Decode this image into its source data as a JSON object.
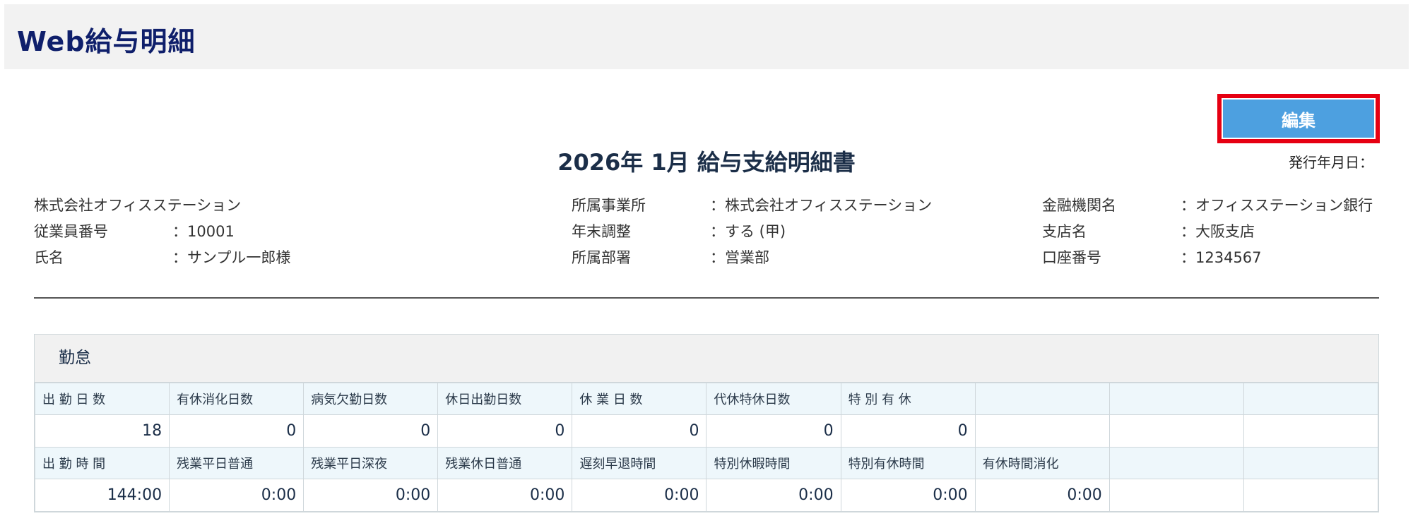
{
  "app": {
    "title": "Web給与明細"
  },
  "toolbar": {
    "edit_label": "編集"
  },
  "document": {
    "title": "2026年 1月 給与支給明細書",
    "issue_date_label": "発行年月日："
  },
  "info": {
    "company": "株式会社オフィスステーション",
    "employee_no": {
      "label": "従業員番号",
      "value": "：10001"
    },
    "name": {
      "label": "氏名",
      "value": "：サンプル一郎様"
    },
    "office": {
      "label": "所属事業所",
      "value": "：株式会社オフィスステーション"
    },
    "year_end": {
      "label": "年末調整",
      "value": "：する (甲)"
    },
    "department": {
      "label": "所属部署",
      "value": "：営業部"
    },
    "bank": {
      "label": "金融機関名",
      "value": "：オフィスステーション銀行"
    },
    "branch": {
      "label": "支店名",
      "value": "：大阪支店"
    },
    "account": {
      "label": "口座番号",
      "value": "：1234567"
    }
  },
  "attendance": {
    "title": "勤怠",
    "row1_headers": [
      "出 勤 日 数",
      "有休消化日数",
      "病気欠勤日数",
      "休日出勤日数",
      "休 業 日 数",
      "代休特休日数",
      "特 別 有 休",
      "",
      "",
      ""
    ],
    "row1_values": [
      "18",
      "0",
      "0",
      "0",
      "0",
      "0",
      "0",
      "",
      "",
      ""
    ],
    "row2_headers": [
      "出 勤 時 間",
      "残業平日普通",
      "残業平日深夜",
      "残業休日普通",
      "遅刻早退時間",
      "特別休暇時間",
      "特別有休時間",
      "有休時間消化",
      "",
      ""
    ],
    "row2_values": [
      "144:00",
      "0:00",
      "0:00",
      "0:00",
      "0:00",
      "0:00",
      "0:00",
      "0:00",
      "",
      ""
    ]
  },
  "colors": {
    "header_bg": "#f2f2f2",
    "title_color": "#0f1f6b",
    "edit_button_bg": "#4da0e0",
    "highlight_border": "#e60012",
    "table_head_bg": "#eef7fb"
  }
}
